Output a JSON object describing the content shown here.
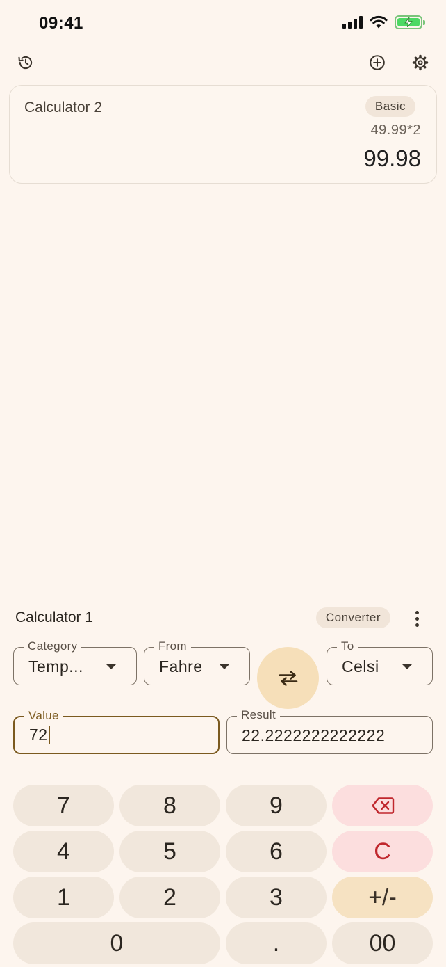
{
  "status_bar": {
    "time": "09:41"
  },
  "toolbar": {
    "history_icon": "history-icon",
    "add_icon": "add-circle-icon",
    "settings_icon": "gear-icon"
  },
  "calculator_2": {
    "title": "Calculator 2",
    "mode": "Basic",
    "expression": "49.99*2",
    "result": "99.98"
  },
  "calculator_1": {
    "title": "Calculator 1",
    "mode": "Converter",
    "category": {
      "label": "Category",
      "value": "Temp..."
    },
    "from": {
      "label": "From",
      "value": "Fahre"
    },
    "to": {
      "label": "To",
      "value": "Celsi"
    },
    "value_field": {
      "label": "Value",
      "value": "72"
    },
    "result_field": {
      "label": "Result",
      "value": "22.2222222222222"
    }
  },
  "keypad": {
    "k7": "7",
    "k8": "8",
    "k9": "9",
    "k4": "4",
    "k5": "5",
    "k6": "6",
    "k1": "1",
    "k2": "2",
    "k3": "3",
    "k0": "0",
    "kdot": ".",
    "k00": "00",
    "clear": "C",
    "sign": "+/-"
  },
  "colors": {
    "background": "#fdf5ee",
    "key": "#f1e7dc",
    "key_danger": "#fcdede",
    "key_accent": "#f6e2c2",
    "swap": "#f6dfb9",
    "focus": "#7b5a1f"
  }
}
